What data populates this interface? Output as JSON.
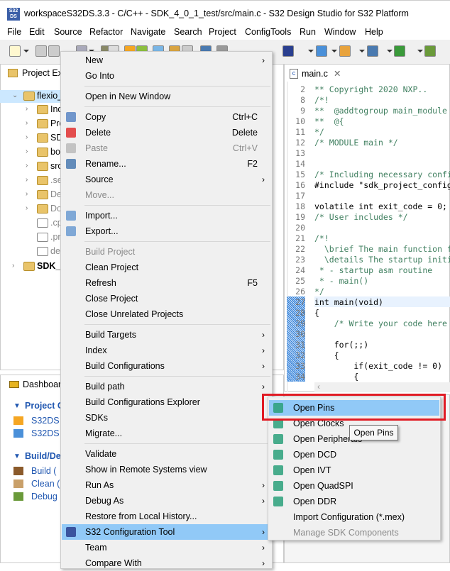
{
  "window": {
    "title": "workspaceS32DS.3.3 - C/C++ - SDK_4_0_1_test/src/main.c - S32 Design Studio for S32 Platform",
    "app_icon": "S32 DS"
  },
  "menubar": [
    "File",
    "Edit",
    "Source",
    "Refactor",
    "Navigate",
    "Search",
    "Project",
    "ConfigTools",
    "Run",
    "Window",
    "Help"
  ],
  "project_explorer": {
    "tab": "Project Exp",
    "tree": [
      {
        "label": "flexio_",
        "level": 0,
        "selected": true,
        "expanded": true
      },
      {
        "label": "Inc",
        "level": 1
      },
      {
        "label": "Pro",
        "level": 1
      },
      {
        "label": "SD",
        "level": 1
      },
      {
        "label": "bo",
        "level": 1
      },
      {
        "label": "sro",
        "level": 1
      },
      {
        "label": ".se",
        "level": 1,
        "dim": true
      },
      {
        "label": "De",
        "level": 1,
        "dim": true
      },
      {
        "label": "Do",
        "level": 1,
        "dim": true
      },
      {
        "label": ".cp",
        "level": 1,
        "dim": true,
        "file": true
      },
      {
        "label": ".pr",
        "level": 1,
        "dim": true,
        "file": true
      },
      {
        "label": "de",
        "level": 1,
        "dim": true,
        "file": true
      },
      {
        "label": "SDK_4",
        "level": 0,
        "bold": true
      }
    ]
  },
  "dashboard": {
    "tab": "Dashboard",
    "sections": [
      {
        "title": "Project C",
        "items": [
          "S32DS A",
          "S32DS L"
        ]
      },
      {
        "title": "Build/De",
        "items": [
          "Build  (",
          "Clean  (",
          "Debug"
        ]
      }
    ]
  },
  "editor": {
    "tab": "main.c",
    "lines": [
      [
        "2",
        "** Copyright 2020 NXP..",
        "c"
      ],
      [
        "8",
        "/*!",
        "c"
      ],
      [
        "9",
        "**  @addtogroup main_module",
        "c"
      ],
      [
        "10",
        "**  @{",
        "c"
      ],
      [
        "11",
        "*/",
        "c"
      ],
      [
        "12",
        "/* MODULE main */",
        "c"
      ],
      [
        "13",
        "",
        ""
      ],
      [
        "14",
        "",
        ""
      ],
      [
        "15",
        "/* Including necessary confi",
        "c"
      ],
      [
        "16",
        "#include \"sdk_project_config",
        "k"
      ],
      [
        "17",
        "",
        ""
      ],
      [
        "18",
        "volatile int exit_code = 0;",
        "k"
      ],
      [
        "19",
        "/* User includes */",
        "c"
      ],
      [
        "20",
        "",
        ""
      ],
      [
        "21",
        "/*!",
        "c"
      ],
      [
        "22",
        "  \\brief The main function f",
        "c"
      ],
      [
        "23",
        "  \\details The startup initi",
        "c"
      ],
      [
        "24",
        " * - startup asm routine",
        "c"
      ],
      [
        "25",
        " * - main()",
        "c"
      ],
      [
        "26",
        "*/",
        "c"
      ],
      [
        "27",
        "int main(void)",
        "k"
      ],
      [
        "28",
        "{",
        "k"
      ],
      [
        "29",
        "    /* Write your code here",
        "c"
      ],
      [
        "30",
        "",
        ""
      ],
      [
        "31",
        "    for(;;)",
        "k"
      ],
      [
        "32",
        "    {",
        "k"
      ],
      [
        "33",
        "        if(exit_code != 0)",
        "k"
      ],
      [
        "34",
        "        {",
        "k"
      ]
    ]
  },
  "context_menu": [
    {
      "label": "New",
      "arrow": true
    },
    {
      "label": "Go Into"
    },
    {
      "sep": true
    },
    {
      "label": "Open in New Window"
    },
    {
      "sep": true
    },
    {
      "label": "Copy",
      "shortcut": "Ctrl+C",
      "icon": "copy-icon"
    },
    {
      "label": "Delete",
      "shortcut": "Delete",
      "icon": "delete-icon"
    },
    {
      "label": "Paste",
      "shortcut": "Ctrl+V",
      "disabled": true,
      "icon": "paste-icon"
    },
    {
      "label": "Rename...",
      "shortcut": "F2",
      "icon": "rename-icon"
    },
    {
      "label": "Source",
      "arrow": true
    },
    {
      "label": "Move...",
      "disabled": true
    },
    {
      "sep": true
    },
    {
      "label": "Import...",
      "icon": "import-icon"
    },
    {
      "label": "Export...",
      "icon": "export-icon"
    },
    {
      "sep": true
    },
    {
      "label": "Build Project",
      "disabled": true
    },
    {
      "label": "Clean Project"
    },
    {
      "label": "Refresh",
      "shortcut": "F5"
    },
    {
      "label": "Close Project"
    },
    {
      "label": "Close Unrelated Projects"
    },
    {
      "sep": true
    },
    {
      "label": "Build Targets",
      "arrow": true
    },
    {
      "label": "Index",
      "arrow": true
    },
    {
      "label": "Build Configurations",
      "arrow": true
    },
    {
      "sep": true
    },
    {
      "label": "Build path",
      "arrow": true
    },
    {
      "label": "Build Configurations Explorer"
    },
    {
      "label": "SDKs"
    },
    {
      "label": "Migrate..."
    },
    {
      "sep": true
    },
    {
      "label": "Validate"
    },
    {
      "label": "Show in Remote Systems view"
    },
    {
      "label": "Run As",
      "arrow": true
    },
    {
      "label": "Debug As",
      "arrow": true
    },
    {
      "label": "Restore from Local History..."
    },
    {
      "label": "S32 Configuration Tool",
      "arrow": true,
      "highlighted": true,
      "icon": "chip-icon"
    },
    {
      "label": "Team",
      "arrow": true
    },
    {
      "label": "Compare With",
      "arrow": true
    }
  ],
  "submenu": [
    {
      "label": "Open Pins",
      "highlighted": true,
      "icon": "pins-icon"
    },
    {
      "label": "Open Clocks",
      "icon": "clocks-icon"
    },
    {
      "label": "Open Peripherals",
      "icon": "usb-icon"
    },
    {
      "label": "Open DCD",
      "icon": "dcd-icon"
    },
    {
      "label": "Open IVT",
      "icon": "ivt-icon"
    },
    {
      "label": "Open QuadSPI",
      "icon": "quadspi-icon"
    },
    {
      "label": "Open DDR",
      "icon": "ddr-icon"
    },
    {
      "label": "Import Configuration (*.mex)"
    },
    {
      "label": "Manage SDK Components",
      "disabled": true
    }
  ],
  "tooltip": "Open Pins",
  "colors": {
    "highlight": "#91c9f7",
    "annotation": "#e01b24",
    "link": "#1f56b0"
  }
}
